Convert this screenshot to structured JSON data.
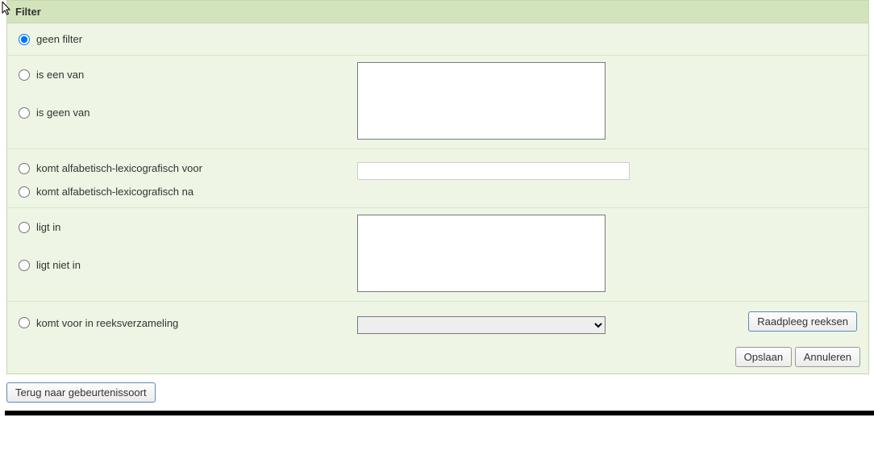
{
  "header": {
    "title": "Filter"
  },
  "filters": {
    "none": {
      "label": "geen filter",
      "checked": true
    },
    "is_one_of": {
      "label": "is een van"
    },
    "is_not_one_of": {
      "label": "is geen van"
    },
    "alpha_before": {
      "label": "komt alfabetisch-lexicografisch voor"
    },
    "alpha_after": {
      "label": "komt alfabetisch-lexicografisch na"
    },
    "in_range": {
      "label": "ligt in"
    },
    "not_in_range": {
      "label": "ligt niet in"
    },
    "in_series": {
      "label": "komt voor in reeksverzameling"
    }
  },
  "inputs": {
    "list1_value": "",
    "alpha_value": "",
    "list2_value": "",
    "series_value": ""
  },
  "buttons": {
    "consult_series": "Raadpleeg reeksen",
    "save": "Opslaan",
    "cancel": "Annuleren",
    "back": "Terug naar gebeurtenissoort"
  }
}
